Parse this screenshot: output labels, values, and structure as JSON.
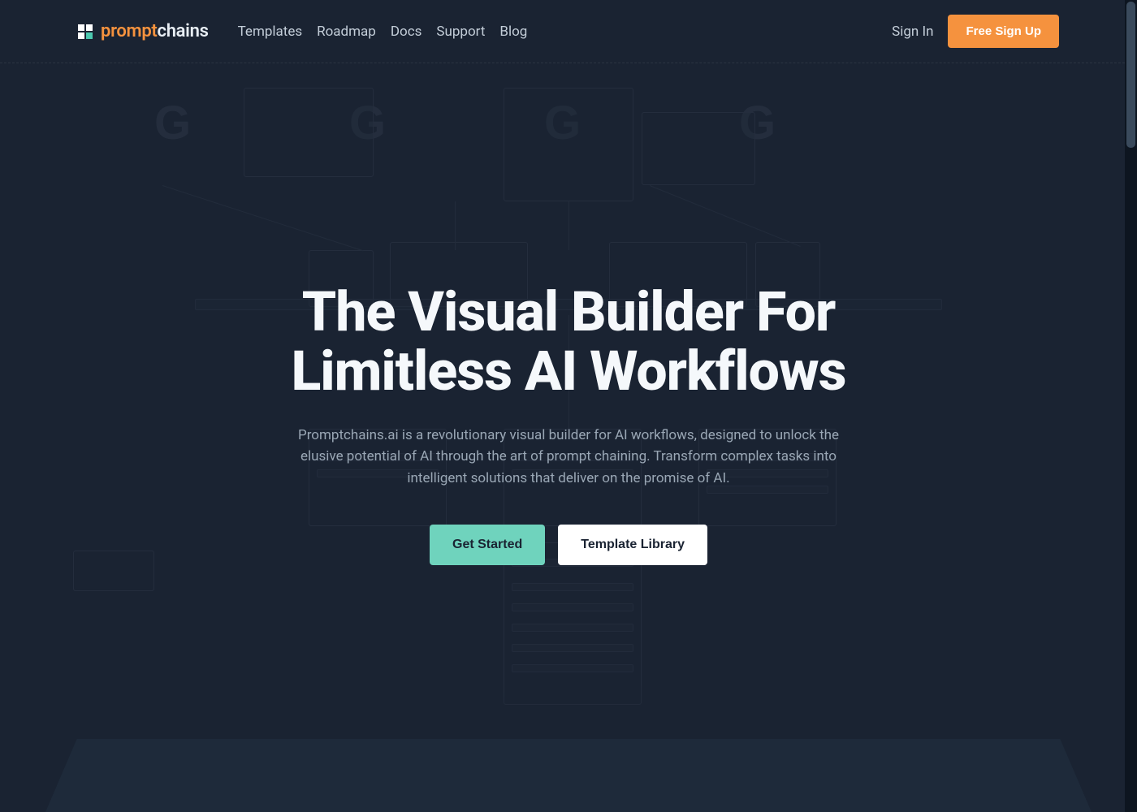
{
  "header": {
    "logo": {
      "part1": "prompt",
      "part2": "chains"
    },
    "nav": {
      "templates": "Templates",
      "roadmap": "Roadmap",
      "docs": "Docs",
      "support": "Support",
      "blog": "Blog"
    },
    "signin": "Sign In",
    "signup": "Free Sign Up"
  },
  "hero": {
    "title_line1": "The Visual Builder For",
    "title_line2": "Limitless AI Workflows",
    "subtitle": "Promptchains.ai is a revolutionary visual builder for AI workflows, designed to unlock the elusive potential of AI through the art of prompt chaining. Transform complex tasks into intelligent solutions that deliver on the promise of AI.",
    "cta_primary": "Get Started",
    "cta_secondary": "Template Library"
  },
  "colors": {
    "accent_orange": "#f5923e",
    "accent_teal": "#6fd3bd",
    "bg": "#1a2332"
  }
}
